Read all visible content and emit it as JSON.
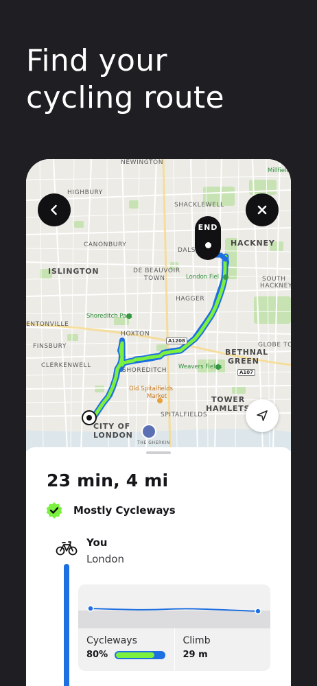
{
  "headline": {
    "line1": "Find your",
    "line2": "cycling route"
  },
  "map": {
    "labels": {
      "newington": "NEWINGTON",
      "highbury": "HIGHBURY",
      "shacklewell": "SHACKLEWELL",
      "canonbury": "CANONBURY",
      "dalston": "DALSTON",
      "hackney": "HACKNEY",
      "islington": "ISLINGTON",
      "de_beauvoir": "DE BEAUVOIR",
      "town": "TOWN",
      "london_fields": "London Fiel",
      "south_hackney_1": "SOUTH",
      "south_hackney_2": "HACKNEY",
      "shoreditch_park": "Shoreditch Park",
      "haggerston": "HAGGER",
      "pentonville": "ENTONVILLE",
      "hoxton": "HOXTON",
      "finsbury": "FINSBURY",
      "bethnal_1": "BETHNAL",
      "bethnal_2": "GREEN",
      "globe_town": "GLOBE TOWN",
      "clerkenwell": "CLERKENWELL",
      "weavers_fields": "Weavers Fields",
      "shoreditch": "SHOREDITCH",
      "spitalfields_market_1": "Old Spitalfields",
      "spitalfields_market_2": "Market",
      "tower_1": "TOWER",
      "tower_2": "HAMLETS",
      "spitalfields": "SPITALFIELDS",
      "city_1": "CITY OF",
      "city_2": "LONDON",
      "gherkin": "THE GHERKIN",
      "millfields": "Millfields",
      "road_a1208": "A1208",
      "road_a107": "A107"
    },
    "end_pin_label": "END",
    "route_color": "#7cf03f",
    "route_edge_color": "#1e6fe0"
  },
  "buttons": {
    "back": "back-icon",
    "close": "close-icon",
    "locate": "navigation-arrow-icon"
  },
  "summary": {
    "duration_distance": "23 min, 4 mi",
    "badge": "Mostly Cycleways",
    "badge_color": "#7cf03f"
  },
  "origin": {
    "name": "You",
    "place": "London",
    "icon": "bicycle-icon"
  },
  "stats": {
    "cycleways_label": "Cycleways",
    "cycleways_value": "80%",
    "cycleways_fraction": 0.8,
    "climb_label": "Climb",
    "climb_value": "29 m"
  },
  "colors": {
    "accent_blue": "#1e6fe0",
    "accent_green": "#7cf03f",
    "background": "#1f1f23"
  }
}
